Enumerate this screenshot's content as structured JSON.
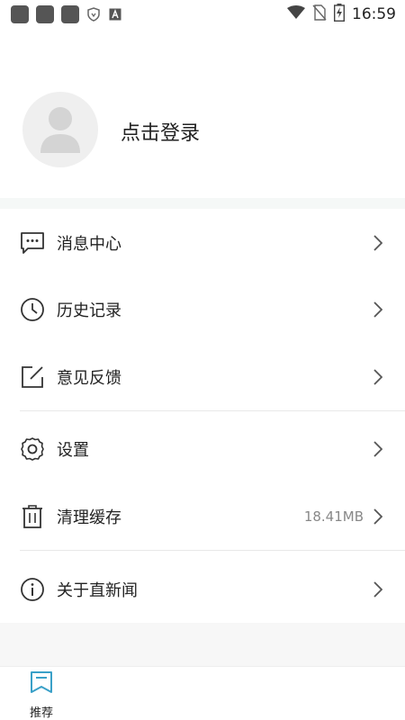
{
  "status_bar": {
    "time": "16:59",
    "left_icons": [
      "app-icon",
      "app-icon",
      "app-icon",
      "shield-icon",
      "a-icon"
    ],
    "right_icons": [
      "wifi-icon",
      "no-sim-icon",
      "battery-charging-icon"
    ]
  },
  "profile": {
    "login_label": "点击登录"
  },
  "menu": {
    "items": [
      {
        "label": "消息中心",
        "icon": "message-icon"
      },
      {
        "label": "历史记录",
        "icon": "clock-icon"
      },
      {
        "label": "意见反馈",
        "icon": "edit-icon"
      },
      {
        "label": "设置",
        "icon": "gear-icon"
      },
      {
        "label": "清理缓存",
        "icon": "trash-icon",
        "value": "18.41MB"
      },
      {
        "label": "关于直新闻",
        "icon": "info-icon"
      }
    ]
  },
  "bottom_nav": {
    "items": [
      {
        "label": "推荐",
        "icon": "bookmark-icon",
        "active": true
      }
    ]
  },
  "colors": {
    "accent": "#3aa0c8",
    "text": "#222222",
    "secondary_text": "#888888",
    "divider": "#e8e8e8"
  }
}
